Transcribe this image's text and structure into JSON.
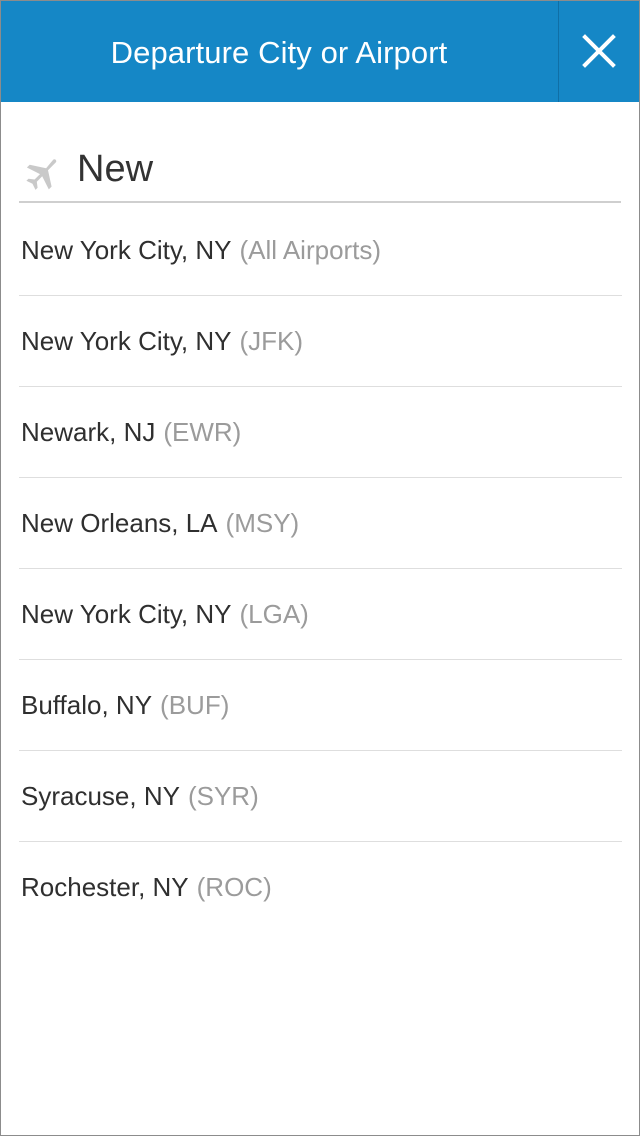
{
  "header": {
    "title": "Departure City or Airport",
    "close_icon": "close-icon",
    "background_color": "#1587c6"
  },
  "search": {
    "value": "New",
    "icon": "plane-icon"
  },
  "results": [
    {
      "city": "New York City, NY",
      "code": "(All Airports)"
    },
    {
      "city": "New York City, NY",
      "code": "(JFK)"
    },
    {
      "city": "Newark, NJ",
      "code": "(EWR)"
    },
    {
      "city": "New Orleans, LA",
      "code": "(MSY)"
    },
    {
      "city": "New York City, NY",
      "code": "(LGA)"
    },
    {
      "city": "Buffalo, NY",
      "code": "(BUF)"
    },
    {
      "city": "Syracuse, NY",
      "code": "(SYR)"
    },
    {
      "city": "Rochester, NY",
      "code": "(ROC)"
    }
  ]
}
